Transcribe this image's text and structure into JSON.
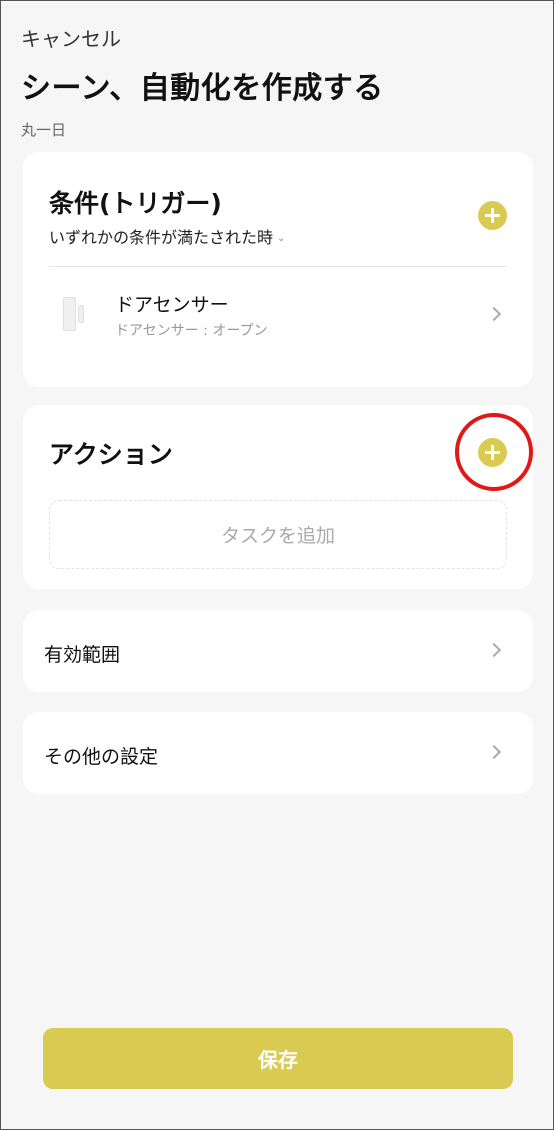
{
  "header": {
    "cancel_label": "キャンセル",
    "title": "シーン、自動化を作成する",
    "subtitle": "丸一日"
  },
  "trigger": {
    "title": "条件(トリガー)",
    "condition_select": "いずれかの条件が満たされた時",
    "device": {
      "name": "ドアセンサー",
      "state": "ドアセンサー : オープン"
    }
  },
  "action": {
    "title": "アクション",
    "add_task_label": "タスクを追加"
  },
  "rows": {
    "scope_label": "有効範囲",
    "other_settings_label": "その他の設定"
  },
  "footer": {
    "save_label": "保存"
  },
  "colors": {
    "accent": "#d9cb52",
    "highlight_ring": "#e01818",
    "background": "#f6f6f6"
  },
  "icons": {
    "add": "plus-circle-icon",
    "navigate": "chevron-right-icon",
    "device": "door-sensor-icon",
    "dropdown": "chevron-down-icon"
  }
}
